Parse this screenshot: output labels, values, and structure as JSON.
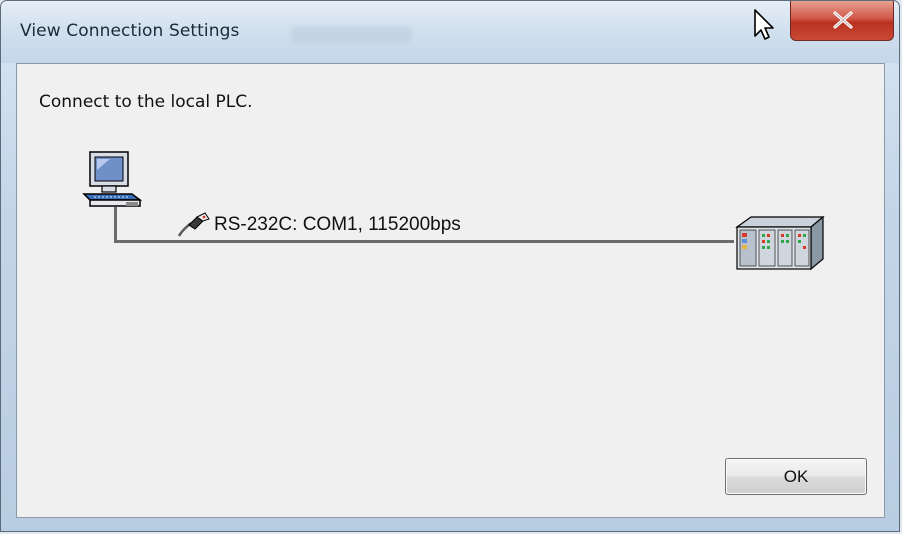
{
  "window": {
    "title": "View Connection Settings"
  },
  "titlebar": {
    "close_icon": "close-icon",
    "cursor_icon": "mouse-pointer-icon"
  },
  "content": {
    "message": "Connect to the local PLC.",
    "connection_label": "RS-232C: COM1, 115200bps",
    "pc_icon": "computer-icon",
    "cable_icon": "serial-cable-icon",
    "plc_icon": "plc-icon"
  },
  "buttons": {
    "ok_label": "OK"
  },
  "colors": {
    "close_button": "#c8493a",
    "client_background": "#f0f0f0",
    "connection_line": "#6b6b6b"
  }
}
